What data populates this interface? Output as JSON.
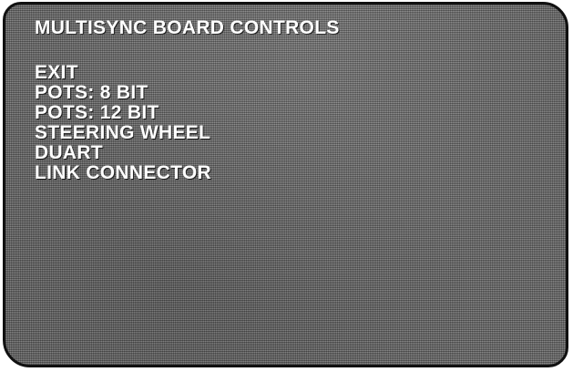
{
  "screen": {
    "title": "MULTISYNC BOARD CONTROLS",
    "menu_items": [
      {
        "label": "EXIT"
      },
      {
        "label": "POTS: 8 BIT"
      },
      {
        "label": "POTS: 12 BIT"
      },
      {
        "label": "STEERING WHEEL"
      },
      {
        "label": "DUART"
      },
      {
        "label": "LINK CONNECTOR"
      }
    ]
  },
  "colors": {
    "text": "#ffffff",
    "screen_background": "#6f6f6f",
    "border": "#111111"
  }
}
